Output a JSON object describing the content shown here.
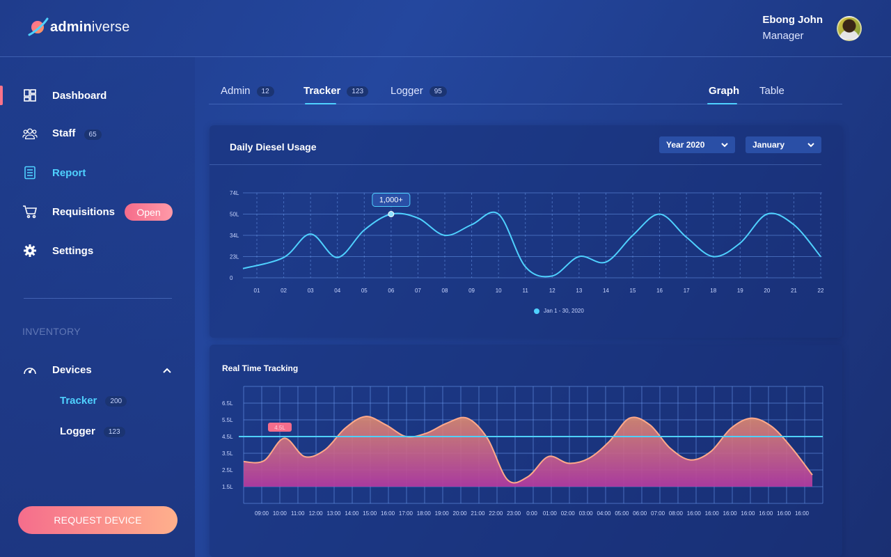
{
  "brand": {
    "name_bold": "admin",
    "name_light": "iverse"
  },
  "user": {
    "name": "Ebong John",
    "role": "Manager"
  },
  "sidebar": {
    "items": [
      {
        "label": "Dashboard"
      },
      {
        "label": "Staff",
        "badge": "65"
      },
      {
        "label": "Report"
      },
      {
        "label": "Requisitions",
        "badge": "Open"
      },
      {
        "label": "Settings"
      }
    ],
    "section_label": "INVENTORY",
    "devices": {
      "label": "Devices",
      "children": [
        {
          "label": "Tracker",
          "badge": "200"
        },
        {
          "label": "Logger",
          "badge": "123"
        }
      ]
    },
    "request_button": "REQUEST DEVICE"
  },
  "tabs": [
    {
      "label": "Admin",
      "badge": "12"
    },
    {
      "label": "Tracker",
      "badge": "123"
    },
    {
      "label": "Logger",
      "badge": "95"
    }
  ],
  "view_tabs": [
    {
      "label": "Graph"
    },
    {
      "label": "Table"
    }
  ],
  "colors": {
    "accent": "#4fd1ff",
    "pink": "#f56d8c",
    "orange": "#ffb08c"
  },
  "chart_data": [
    {
      "type": "line",
      "title": "Daily Diesel Usage",
      "filters": {
        "year": "Year 2020",
        "month": "January"
      },
      "categories": [
        "01",
        "02",
        "03",
        "04",
        "05",
        "06",
        "07",
        "08",
        "09",
        "10",
        "11",
        "12",
        "13",
        "14",
        "15",
        "16",
        "17",
        "18",
        "19",
        "20",
        "21",
        "22"
      ],
      "y_ticks": [
        "0",
        "23L",
        "34L",
        "50L",
        "74L"
      ],
      "series": [
        {
          "name": "Jan 1 -  30, 2020",
          "values": [
            10,
            22,
            35,
            22,
            38,
            50,
            47,
            34,
            42,
            50,
            12,
            2,
            23,
            17,
            34,
            50,
            33,
            23,
            30,
            50,
            42,
            23
          ]
        }
      ],
      "annotation": {
        "label": "1,000+",
        "category": "06"
      },
      "grid": true,
      "legend": "bottom-center"
    },
    {
      "type": "area",
      "title": "Real Time Tracking",
      "categories": [
        "09:00",
        "10:00",
        "11:00",
        "12:00",
        "13:00",
        "14:00",
        "15:00",
        "16:00",
        "17:00",
        "18:00",
        "19:00",
        "20:00",
        "21:00",
        "22:00",
        "23:00",
        "0:00",
        "01:00",
        "02:00",
        "03:00",
        "04:00",
        "05:00",
        "06:00",
        "07:00",
        "08:00",
        "16:00",
        "16:00",
        "16:00",
        "16:00",
        "16:00",
        "16:00",
        "16:00"
      ],
      "y_ticks": [
        "1.5L",
        "2.5L",
        "3.5L",
        "4.5L",
        "5.5L",
        "6.5L"
      ],
      "values": [
        3.0,
        3.05,
        4.4,
        3.3,
        3.7,
        5.0,
        5.7,
        5.2,
        4.5,
        4.7,
        5.3,
        5.6,
        4.4,
        1.9,
        2.1,
        3.3,
        2.9,
        3.2,
        4.2,
        5.6,
        5.2,
        3.8,
        3.1,
        3.6,
        5.0,
        5.6,
        5.1,
        3.8,
        2.2
      ],
      "threshold": {
        "value": 4.5,
        "label": "4.5L"
      },
      "grid": true
    }
  ]
}
